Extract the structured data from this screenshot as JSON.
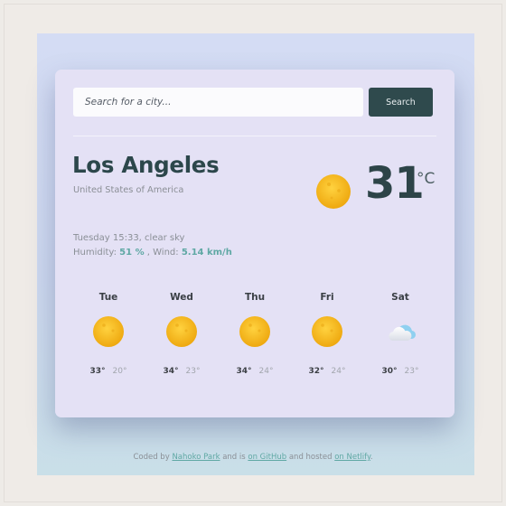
{
  "search": {
    "placeholder": "Search for a city...",
    "button_label": "Search"
  },
  "current": {
    "city": "Los Angeles",
    "country": "United States of America",
    "temperature": "31",
    "unit": "°C",
    "icon": "sun-icon",
    "description": "Tuesday 15:33, clear sky",
    "humidity_label": "Humidity: ",
    "humidity_value": "51 %",
    "wind_label": " , Wind: ",
    "wind_value": "5.14 km/h"
  },
  "forecast": [
    {
      "day": "Tue",
      "max": "33°",
      "min": "20°",
      "icon": "sun-icon"
    },
    {
      "day": "Wed",
      "max": "34°",
      "min": "23°",
      "icon": "sun-icon"
    },
    {
      "day": "Thu",
      "max": "34°",
      "min": "24°",
      "icon": "sun-icon"
    },
    {
      "day": "Fri",
      "max": "32°",
      "min": "24°",
      "icon": "sun-icon"
    },
    {
      "day": "Sat",
      "max": "30°",
      "min": "23°",
      "icon": "cloud-icon"
    }
  ],
  "footer": {
    "prefix": "Coded by ",
    "author_link": "Nahoko Park",
    "middle": " and is ",
    "github_link": "on GitHub",
    "middle2": " and hosted ",
    "netlify_link": "on Netlify"
  },
  "colors": {
    "accent": "#5fa8a4",
    "button": "#2f4a4d",
    "sun": "#f2b824"
  }
}
